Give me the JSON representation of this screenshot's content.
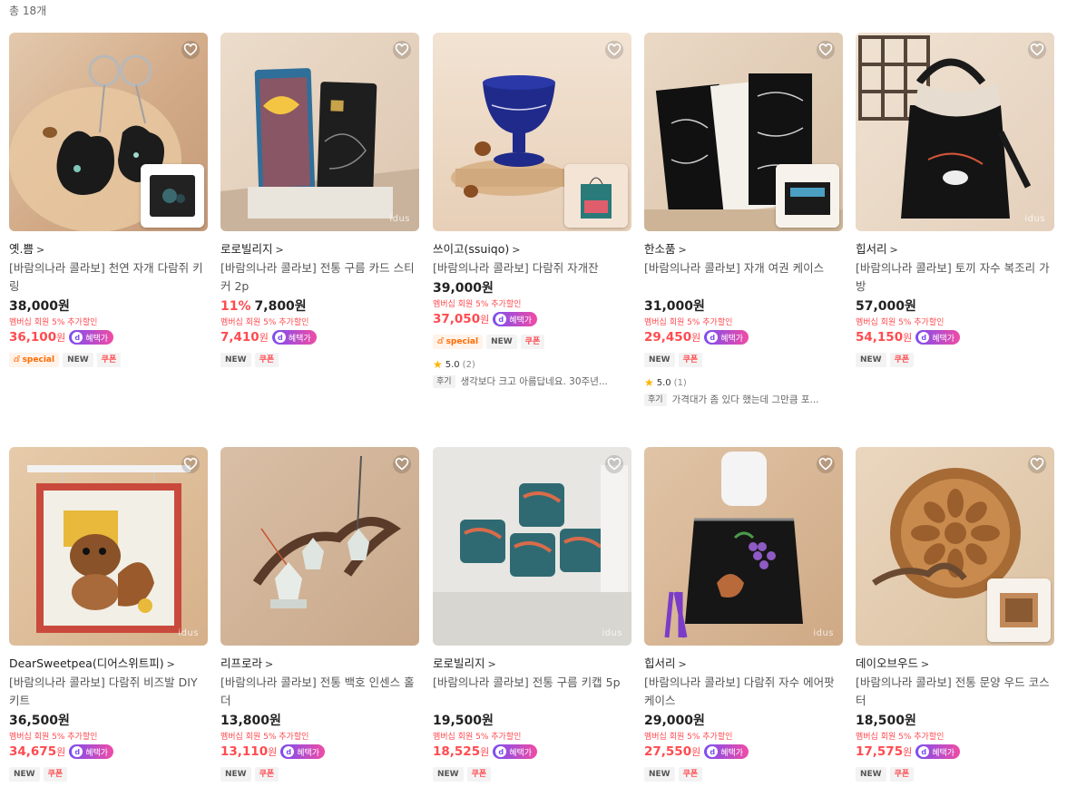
{
  "total_count": "총 18개",
  "colors": {
    "accent": "#ff4b50",
    "perk_start": "#7b4df2",
    "perk_end": "#f04ca5"
  },
  "products": [
    {
      "shop": "옛.쁨",
      "name": "[바람의나라 콜라보] 천연 자개 다람쥐 키링",
      "price": "38,000원",
      "discount": "",
      "membership": "멤버십 회원 5% 추가할인",
      "member_price": "36,100",
      "won": "원",
      "perk": "혜택가",
      "badges": [
        "special",
        "NEW",
        "쿠폰"
      ],
      "rating": "",
      "review_count": "",
      "review_label": "",
      "review": ""
    },
    {
      "shop": "로로빌리지",
      "name": "[바람의나라 콜라보] 전통 구름 카드 스티커 2p",
      "price": "7,800원",
      "discount": "11%",
      "membership": "멤버십 회원 5% 추가할인",
      "member_price": "7,410",
      "won": "원",
      "perk": "혜택가",
      "badges": [
        "NEW",
        "쿠폰"
      ],
      "rating": "",
      "review_count": "",
      "review_label": "",
      "review": ""
    },
    {
      "shop": "쓰이고(ssuiqo)",
      "name": "[바람의나라 콜라보] 다람쥐 자개잔",
      "price": "39,000원",
      "discount": "",
      "membership": "멤버십 회원 5% 추가할인",
      "member_price": "37,050",
      "won": "원",
      "perk": "혜택가",
      "badges": [
        "special",
        "NEW",
        "쿠폰"
      ],
      "rating": "5.0",
      "review_count": "(2)",
      "review_label": "후기",
      "review": "생각보다 크고 아름답네요. 30주년..."
    },
    {
      "shop": "한소품",
      "name": "[바람의나라 콜라보] 자개 여권 케이스",
      "price": "31,000원",
      "discount": "",
      "membership": "멤버십 회원 5% 추가할인",
      "member_price": "29,450",
      "won": "원",
      "perk": "혜택가",
      "badges": [
        "NEW",
        "쿠폰"
      ],
      "rating": "5.0",
      "review_count": "(1)",
      "review_label": "후기",
      "review": "가격대가 좀 있다 했는데 그만큼 포..."
    },
    {
      "shop": "힙서리",
      "name": "[바람의나라 콜라보] 토끼 자수 복조리 가방",
      "price": "57,000원",
      "discount": "",
      "membership": "멤버십 회원 5% 추가할인",
      "member_price": "54,150",
      "won": "원",
      "perk": "혜택가",
      "badges": [
        "NEW",
        "쿠폰"
      ],
      "rating": "",
      "review_count": "",
      "review_label": "",
      "review": ""
    },
    {
      "shop": "DearSweetpea(디어스위트피)",
      "name": "[바람의나라 콜라보] 다람쥐 비즈발 DIY 키트",
      "price": "36,500원",
      "discount": "",
      "membership": "멤버십 회원 5% 추가할인",
      "member_price": "34,675",
      "won": "원",
      "perk": "혜택가",
      "badges": [
        "NEW",
        "쿠폰"
      ],
      "rating": "",
      "review_count": "",
      "review_label": "",
      "review": ""
    },
    {
      "shop": "리프로라",
      "name": "[바람의나라 콜라보] 전통 백호 인센스 홀더",
      "price": "13,800원",
      "discount": "",
      "membership": "멤버십 회원 5% 추가할인",
      "member_price": "13,110",
      "won": "원",
      "perk": "혜택가",
      "badges": [
        "NEW",
        "쿠폰"
      ],
      "rating": "",
      "review_count": "",
      "review_label": "",
      "review": ""
    },
    {
      "shop": "로로빌리지",
      "name": "[바람의나라 콜라보] 전통 구름 키캡 5p",
      "price": "19,500원",
      "discount": "",
      "membership": "멤버십 회원 5% 추가할인",
      "member_price": "18,525",
      "won": "원",
      "perk": "혜택가",
      "badges": [
        "NEW",
        "쿠폰"
      ],
      "rating": "",
      "review_count": "",
      "review_label": "",
      "review": ""
    },
    {
      "shop": "힙서리",
      "name": "[바람의나라 콜라보] 다람쥐 자수 에어팟 케이스",
      "price": "29,000원",
      "discount": "",
      "membership": "멤버십 회원 5% 추가할인",
      "member_price": "27,550",
      "won": "원",
      "perk": "혜택가",
      "badges": [
        "NEW",
        "쿠폰"
      ],
      "rating": "",
      "review_count": "",
      "review_label": "",
      "review": ""
    },
    {
      "shop": "데이오브우드",
      "name": "[바람의나라 콜라보] 전통 문양 우드 코스터",
      "price": "18,500원",
      "discount": "",
      "membership": "멤버십 회원 5% 추가할인",
      "member_price": "17,575",
      "won": "원",
      "perk": "혜택가",
      "badges": [
        "NEW",
        "쿠폰"
      ],
      "rating": "",
      "review_count": "",
      "review_label": "",
      "review": ""
    }
  ],
  "watermark": "idus"
}
